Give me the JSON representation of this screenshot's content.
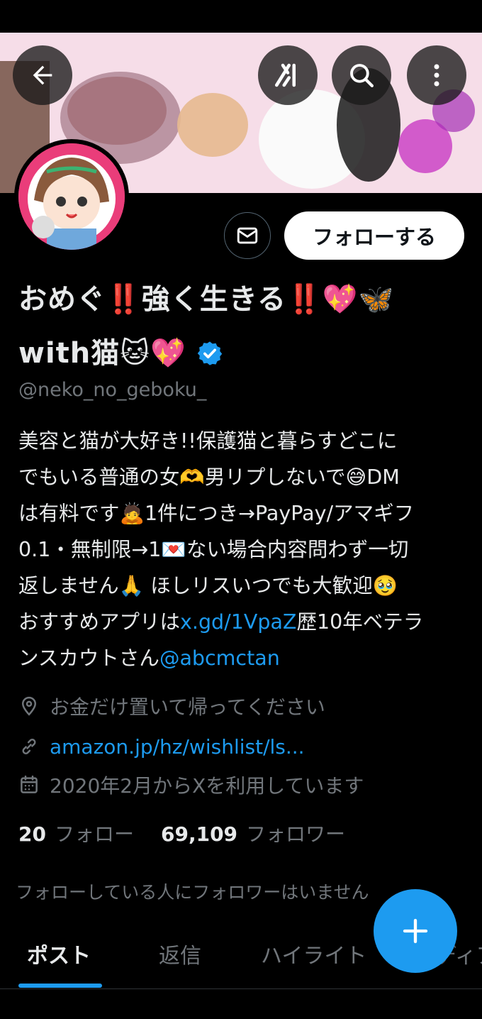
{
  "profile": {
    "name_line1": "おめぐ‼️強く生きる‼️💖🦋",
    "name_line2": "with猫🐱💖",
    "handle": "@neko_no_geboku_",
    "verified": true,
    "follow_button": "フォローする"
  },
  "header_icons": {
    "back": "arrow-left-icon",
    "grok": "grok-icon",
    "search": "search-icon",
    "more": "more-vertical-icon",
    "message": "mail-icon"
  },
  "bio": {
    "line1": "美容と猫が大好き!!保護猫と暮らすどこに",
    "line2": "でもいる普通の女🫶男リプしないで😅DM",
    "line3": "は有料です🙇1件につき→PayPay/アマギフ",
    "line4": "0.1・無制限→1💌ない場合内容問わず一切",
    "line5": "返しません🙏 ほしリスいつでも大歓迎🥹",
    "line6_pre": "おすすめアプリは",
    "line6_link": "x.gd/1VpaZ",
    "line6_post": "歴10年ベテラ",
    "line7_pre": "ンスカウトさん",
    "line7_link": "@abcmctan"
  },
  "meta": {
    "location": "お金だけ置いて帰ってください",
    "website": "amazon.jp/hz/wishlist/ls...",
    "joined": "2020年2月からXを利用しています"
  },
  "stats": {
    "following_count": "20",
    "following_label": "フォロー",
    "followers_count": "69,109",
    "followers_label": "フォロワー"
  },
  "followers_note": "フォローしている人にフォロワーはいません",
  "tabs": [
    {
      "label": "ポスト",
      "active": true
    },
    {
      "label": "返信",
      "active": false
    },
    {
      "label": "ハイライト",
      "active": false
    },
    {
      "label": "メディア",
      "active": false
    }
  ],
  "colors": {
    "accent": "#1d9bf0",
    "background": "#000000",
    "muted": "#71767b",
    "text": "#e7e9ea"
  },
  "fab_icon": "plus-icon"
}
